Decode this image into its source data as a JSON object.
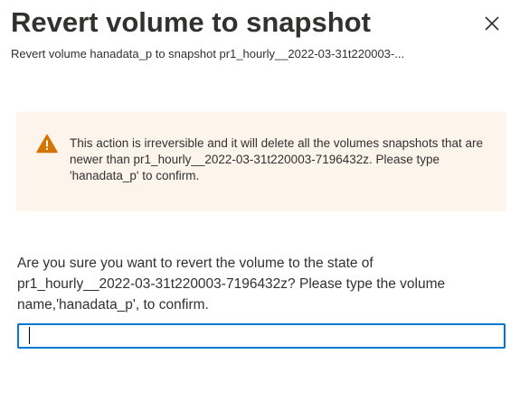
{
  "dialog": {
    "title": "Revert volume to snapshot",
    "subtitle": "Revert volume hanadata_p to snapshot pr1_hourly__2022-03-31t220003-..."
  },
  "icons": {
    "close": "close-icon",
    "warning": "warning-icon"
  },
  "warning": {
    "text": "This action is irreversible and it will delete all the volumes snapshots that are newer than pr1_hourly__2022-03-31t220003-7196432z. Please type 'hanadata_p' to confirm."
  },
  "prompt": {
    "text": "Are you sure you want to revert the volume to the state of pr1_hourly__2022-03-31t220003-7196432z? Please type the volume name,'hanadata_p', to confirm."
  },
  "confirm_input": {
    "value": "",
    "placeholder": ""
  },
  "colors": {
    "accent": "#0078d4",
    "warning_background": "#fdf4ec",
    "warning_icon": "#d47500",
    "text": "#323130"
  }
}
